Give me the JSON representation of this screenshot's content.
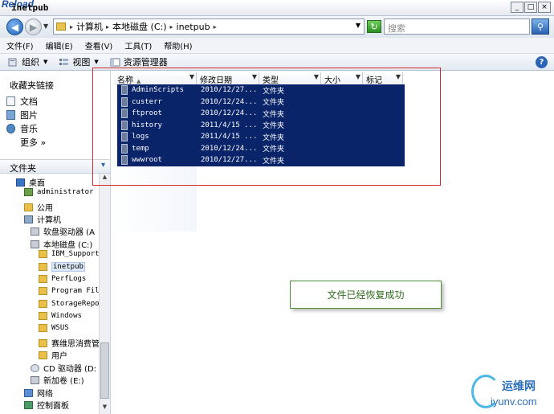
{
  "window": {
    "title": "inetpub",
    "watermark": "Reload"
  },
  "titlebar_buttons": [
    "_",
    "□",
    "×"
  ],
  "address": {
    "crumbs": [
      "计算机",
      "本地磁盘 (C:)",
      "inetpub"
    ],
    "search_placeholder": "搜索"
  },
  "menu": [
    "文件(F)",
    "编辑(E)",
    "查看(V)",
    "工具(T)",
    "帮助(H)"
  ],
  "toolbar": {
    "organize": "组织",
    "views": "视图",
    "explorer": "资源管理器"
  },
  "favorites": {
    "heading": "收藏夹链接",
    "items": [
      "文档",
      "图片",
      "音乐"
    ],
    "more": "更多 »"
  },
  "folders_heading": "文件夹",
  "tree": [
    "桌面",
    "administrator",
    "公用",
    "计算机",
    "软盘驱动器 (A",
    "本地磁盘 (C:)",
    "IBM_Support",
    "inetpub",
    "PerfLogs",
    "Program File",
    "StorageRepor",
    "Windows",
    "WSUS",
    "赛维思消费管",
    "用户",
    "CD 驱动器 (D:",
    "新加卷 (E:)",
    "网络",
    "控制面板"
  ],
  "columns": [
    "名称",
    "修改日期",
    "类型",
    "大小",
    "标记"
  ],
  "files": [
    {
      "name": "AdminScripts",
      "date": "2010/12/27...",
      "type": "文件夹"
    },
    {
      "name": "custerr",
      "date": "2010/12/24...",
      "type": "文件夹"
    },
    {
      "name": "ftproot",
      "date": "2010/12/24...",
      "type": "文件夹"
    },
    {
      "name": "history",
      "date": "2011/4/15 ...",
      "type": "文件夹"
    },
    {
      "name": "logs",
      "date": "2011/4/15 ...",
      "type": "文件夹"
    },
    {
      "name": "temp",
      "date": "2010/12/24...",
      "type": "文件夹"
    },
    {
      "name": "wwwroot",
      "date": "2010/12/27...",
      "type": "文件夹"
    }
  ],
  "note": "文件已经恢复成功",
  "site_watermark": {
    "cn": "运维网",
    "url": "iyunv.com"
  }
}
